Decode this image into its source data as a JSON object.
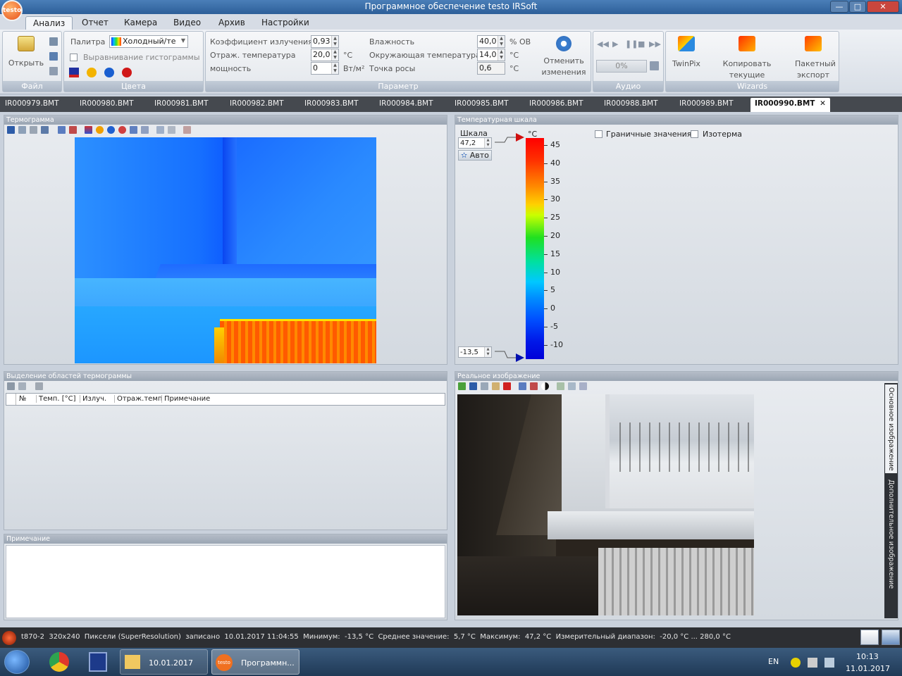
{
  "window": {
    "title": "Программное обеспечение testo IRSoft",
    "logo": "testo",
    "buttons": {
      "min": "—",
      "max": "□",
      "close": "✕"
    }
  },
  "ribbon_tabs": [
    "Анализ",
    "Отчет",
    "Камера",
    "Видео",
    "Архив",
    "Настройки"
  ],
  "groups": {
    "file": {
      "label": "Файл",
      "open": "Открыть"
    },
    "colors": {
      "label": "Цвета",
      "palette_label": "Палитра",
      "palette_value": "Холодный/те",
      "histogram": "Выравнивание гистограммы"
    },
    "params": {
      "label": "Параметр",
      "emissivity_label": "Коэффициент излучения",
      "emissivity": "0,93",
      "refl_label": "Отраж. температура",
      "refl": "20,0",
      "refl_unit": "°C",
      "power_label": "мощность",
      "power": "0",
      "power_unit": "Вт/м²",
      "humidity_label": "Влажность",
      "humidity": "40,0",
      "humidity_unit": "% ОВ",
      "ambient_label": "Окружающая температура",
      "ambient": "14,0",
      "ambient_unit": "°C",
      "dew_label": "Точка росы",
      "dew": "0,6",
      "dew_unit": "°C",
      "undo": "Отменить изменения"
    },
    "audio": {
      "label": "Аудио",
      "progress": "0%",
      "progress_fraction": 0
    },
    "wizards": {
      "label": "Wizards",
      "twinpix": "TwinPix",
      "copy": "Копировать текущие настройки",
      "batch": "Пакетный экспорт"
    }
  },
  "file_tabs": [
    "IR000979.BMT",
    "IR000980.BMT",
    "IR000981.BMT",
    "IR000982.BMT",
    "IR000983.BMT",
    "IR000984.BMT",
    "IR000985.BMT",
    "IR000986.BMT",
    "IR000988.BMT",
    "IR000989.BMT",
    "IR000990.BMT"
  ],
  "active_tab_close": "✕",
  "panels": {
    "thermogram": "Термограмма",
    "scale": "Температурная шкала",
    "regions": "Выделение областей термограммы",
    "note": "Примечание",
    "real": "Реальное изображение"
  },
  "scale": {
    "label": "Шкала",
    "max": "47,2",
    "min": "-13,5",
    "auto": "Авто",
    "unit": "°C",
    "ticks": [
      "45",
      "40",
      "35",
      "30",
      "25",
      "20",
      "15",
      "10",
      "5",
      "0",
      "-5",
      "-10"
    ],
    "limits": "Граничные значения",
    "isotherm": "Изотерма"
  },
  "regions_columns": [
    "№",
    "Темп. [°C]",
    "Излуч.",
    "Отраж.темп",
    "Примечание"
  ],
  "side_tabs": [
    "Основное изображение",
    "Дополнительное изображение"
  ],
  "status": {
    "camera": "t870-2",
    "resolution": "320x240",
    "mode": "Пиксели (SuperResolution)",
    "recorded_label": "записано",
    "recorded": "10.01.2017  11:04:55",
    "min_label": "Минимум:",
    "min": "-13,5 °C",
    "avg_label": "Среднее значение:",
    "avg": "5,7 °C",
    "max_label": "Максимум:",
    "max": "47,2 °C",
    "range_label": "Измерительный диапазон:",
    "range": "-20,0 °C ... 280,0 °C"
  },
  "taskbar": {
    "folder": "10.01.2017",
    "app": "Программн...",
    "app_logo": "testo",
    "lang": "EN",
    "time": "10:13",
    "date": "11.01.2017"
  },
  "colors": {
    "accent": "#2d5f99",
    "tab_dark": "#45494f"
  }
}
